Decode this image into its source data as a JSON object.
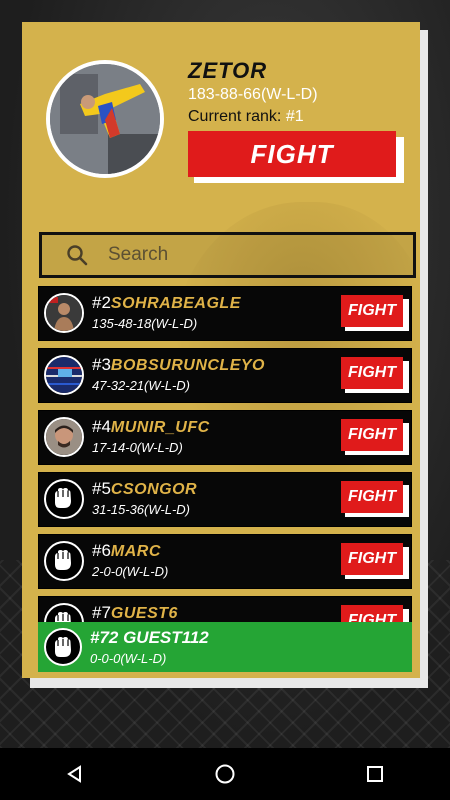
{
  "profile": {
    "username": "ZETOR",
    "record": "183-88-66(W-L-D)",
    "rank_label": "Current rank:",
    "rank_value": "#1",
    "fight_label": "FIGHT"
  },
  "search": {
    "placeholder": "Search"
  },
  "opponents": [
    {
      "rank": "#2",
      "name": "SOHRABEAGLE",
      "record": "135-48-18(W-L-D)",
      "avatar": "ufc-fighter-photo",
      "fight_label": "FIGHT"
    },
    {
      "rank": "#3",
      "name": "BOBSURUNCLEYO",
      "record": "47-32-21(W-L-D)",
      "avatar": "ring-photo",
      "fight_label": "FIGHT"
    },
    {
      "rank": "#4",
      "name": "MUNIR_UFC",
      "record": "17-14-0(W-L-D)",
      "avatar": "face-photo",
      "fight_label": "FIGHT"
    },
    {
      "rank": "#5",
      "name": "CSONGOR",
      "record": "31-15-36(W-L-D)",
      "avatar": "fist-icon",
      "fight_label": "FIGHT"
    },
    {
      "rank": "#6",
      "name": "MARC",
      "record": "2-0-0(W-L-D)",
      "avatar": "fist-icon",
      "fight_label": "FIGHT"
    },
    {
      "rank": "#7",
      "name": "GUEST6",
      "record": "",
      "avatar": "fist-icon",
      "fight_label": "FIGHT"
    }
  ],
  "self_row": {
    "rank_name": "#72 GUEST112",
    "record": "0-0-0(W-L-D)"
  },
  "colors": {
    "gold": "#d4b24c",
    "fight_red": "#e01b1b",
    "self_green": "#25a535",
    "name_gold": "#e0b348"
  },
  "navbar": {
    "icons": [
      "back-icon",
      "home-icon",
      "recents-icon"
    ]
  }
}
